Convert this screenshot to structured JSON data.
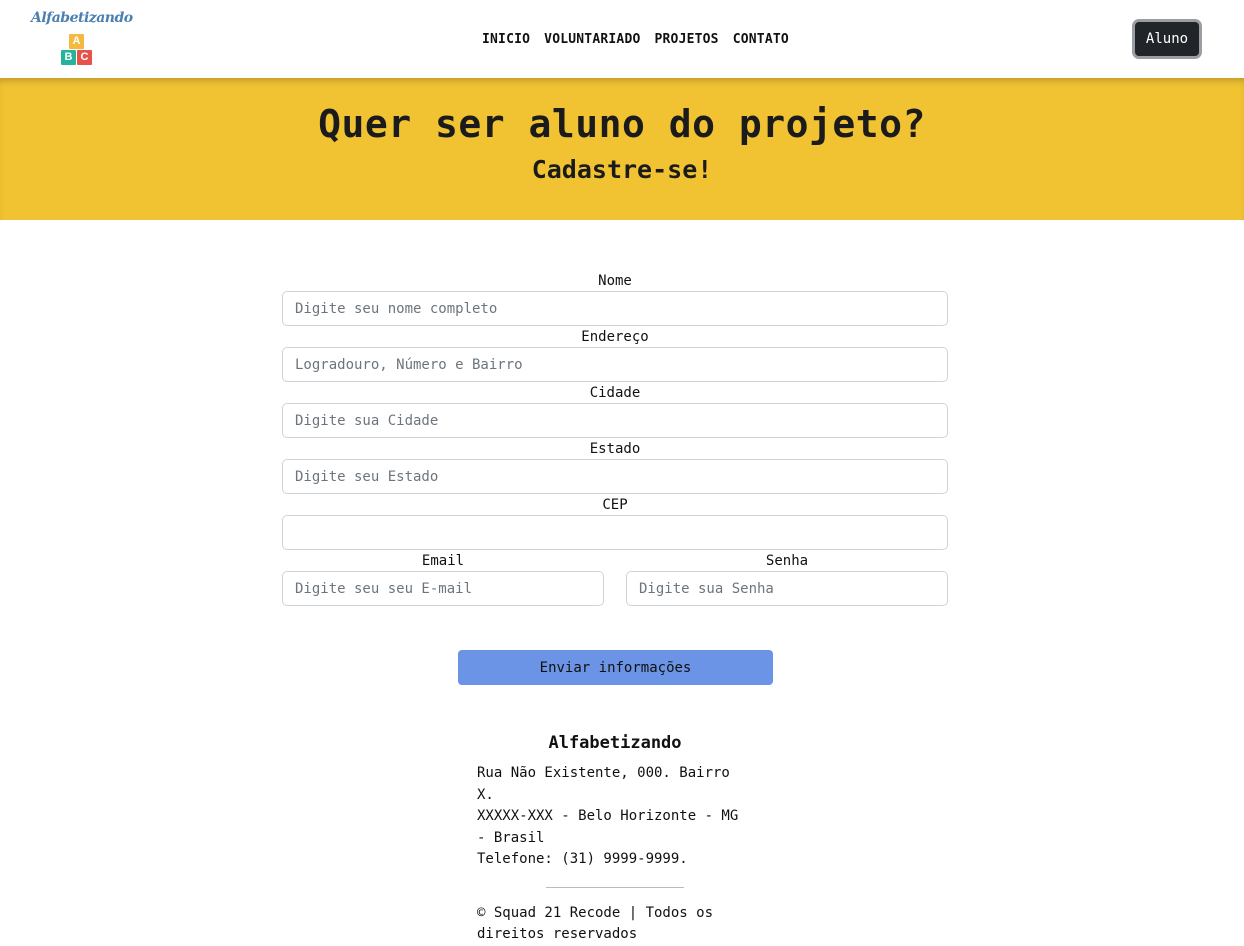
{
  "brand": {
    "name": "Alfabetizando",
    "blocks": [
      "A",
      "B",
      "C"
    ],
    "colors": {
      "text": "#4a7fb0",
      "block_a": "#f5b940",
      "block_b": "#25b39b",
      "block_c": "#e5534b"
    }
  },
  "nav": {
    "links": [
      "INICIO",
      "VOLUNTARIADO",
      "PROJETOS",
      "CONTATO"
    ],
    "aluno_button": "Aluno"
  },
  "hero": {
    "title": "Quer ser aluno do projeto?",
    "subtitle": "Cadastre-se!",
    "background": "#f1c332"
  },
  "form": {
    "nome": {
      "label": "Nome",
      "placeholder": "Digite seu nome completo",
      "value": ""
    },
    "endereco": {
      "label": "Endereço",
      "placeholder": "Logradouro, Número e Bairro",
      "value": ""
    },
    "cidade": {
      "label": "Cidade",
      "placeholder": "Digite sua Cidade",
      "value": ""
    },
    "estado": {
      "label": "Estado",
      "placeholder": "Digite seu Estado",
      "value": ""
    },
    "cep": {
      "label": "CEP",
      "placeholder": "",
      "value": ""
    },
    "email": {
      "label": "Email",
      "placeholder": "Digite seu seu E-mail",
      "value": ""
    },
    "senha": {
      "label": "Senha",
      "placeholder": "Digite sua Senha",
      "value": ""
    },
    "submit_label": "Enviar informações",
    "submit_color": "#6b93e6"
  },
  "footer": {
    "title": "Alfabetizando",
    "address_line1": "Rua Não Existente, 000. Bairro X.",
    "address_line2": "XXXXX-XXX - Belo Horizonte - MG - Brasil",
    "phone": "Telefone: (31) 9999-9999.",
    "copyright": "© Squad 21 Recode | Todos os direitos reservados"
  }
}
